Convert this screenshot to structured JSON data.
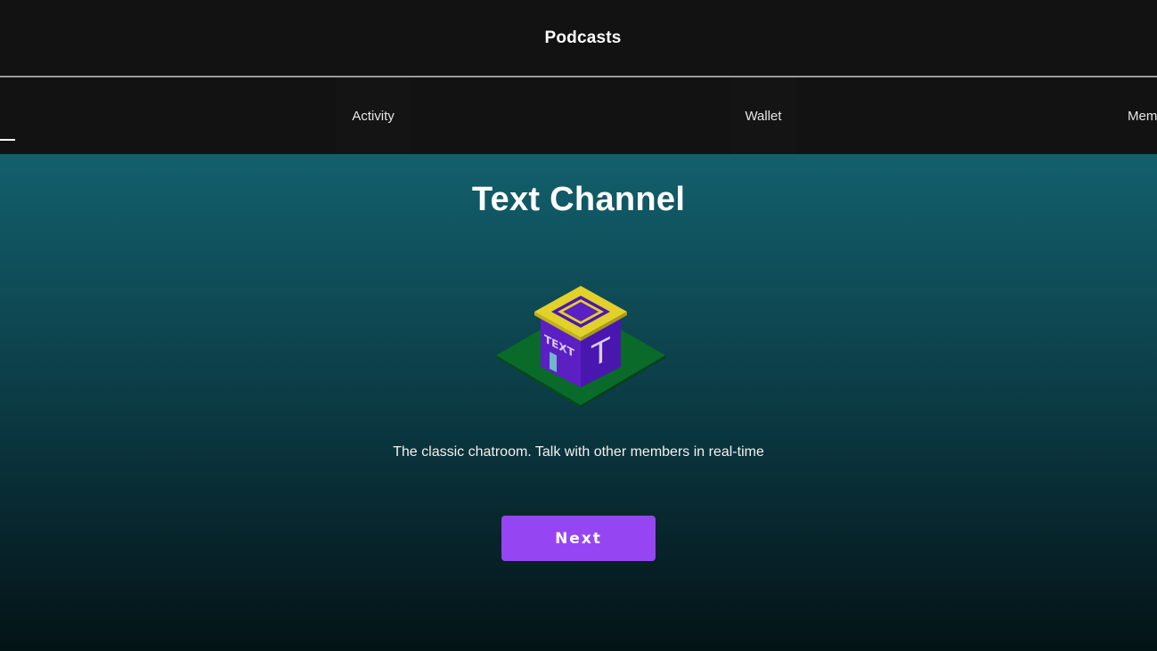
{
  "header": {
    "title": "Podcasts"
  },
  "tabs": [
    {
      "label": "Activity"
    },
    {
      "label": "Wallet"
    },
    {
      "label": "Mem"
    }
  ],
  "onboarding": {
    "title": "Text Channel",
    "illustration": {
      "icon": "text-channel-building-icon",
      "sign_text": "TEXT",
      "letter": "T"
    },
    "description": "The classic chatroom. Talk with other members in real-time",
    "next_label": "Next"
  },
  "colors": {
    "accent": "#9645f2",
    "header_bg": "#121212",
    "gradient_top": "#12606c",
    "gradient_bottom": "#031417"
  }
}
